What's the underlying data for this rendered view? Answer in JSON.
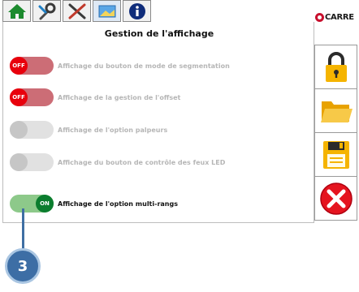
{
  "tabs": [
    {
      "icon": "home-icon"
    },
    {
      "icon": "tools-icon"
    },
    {
      "icon": "settings-icon"
    },
    {
      "icon": "display-icon"
    },
    {
      "icon": "info-icon"
    }
  ],
  "brand": {
    "logo_text": "CARRE"
  },
  "panel": {
    "title": "Gestion de l'affichage"
  },
  "options": [
    {
      "state": "OFF",
      "style": "off-red",
      "label": "Affichage du bouton de mode de segmentation"
    },
    {
      "state": "OFF",
      "style": "off-red",
      "label": "Affichage de la gestion de l'offset"
    },
    {
      "state": "",
      "style": "off-grey",
      "label": "Affichage de l'option palpeurs"
    },
    {
      "state": "",
      "style": "off-grey",
      "label": "Affichage du bouton de contrôle des feux LED"
    },
    {
      "state": "ON",
      "style": "on",
      "label": "Affichage de l'option multi-rangs"
    }
  ],
  "actions": [
    {
      "icon": "lock-icon"
    },
    {
      "icon": "folder-icon"
    },
    {
      "icon": "save-icon"
    },
    {
      "icon": "close-icon"
    }
  ],
  "annotation": {
    "number": "3"
  },
  "colors": {
    "accent_green": "#0b7d2e",
    "off_red": "#e8000c",
    "callout_blue": "#3d6ea5"
  }
}
